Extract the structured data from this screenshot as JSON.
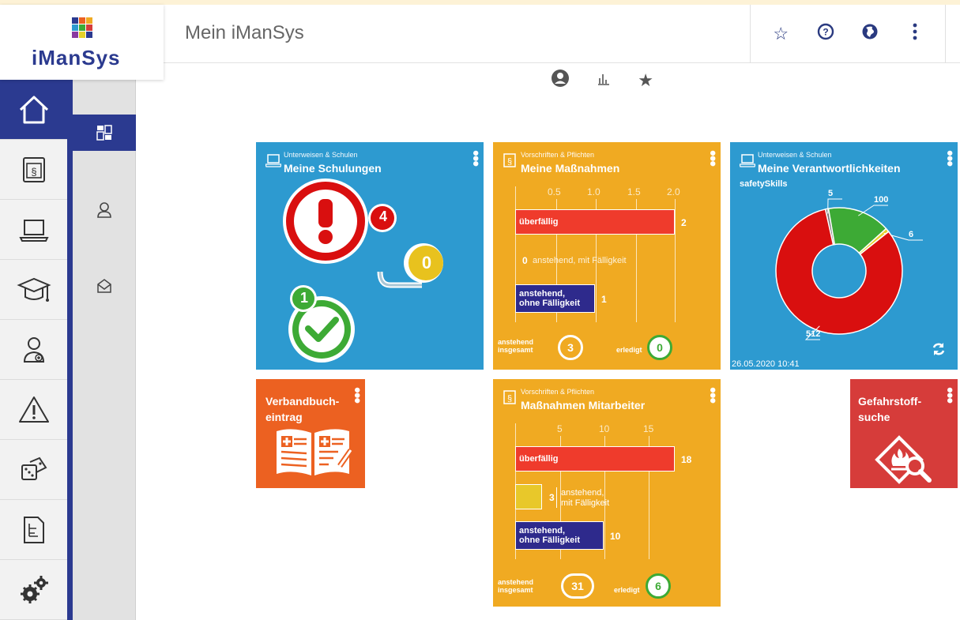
{
  "app": {
    "brand": "iManSys",
    "page_title": "Mein iManSys"
  },
  "header_icons": [
    "star-add-icon",
    "help-icon",
    "globe-icon",
    "more-vertical-icon"
  ],
  "sidebar": {
    "items": [
      {
        "name": "home",
        "active": true
      },
      {
        "name": "regulations"
      },
      {
        "name": "training-laptop"
      },
      {
        "name": "education"
      },
      {
        "name": "first-aid"
      },
      {
        "name": "warning"
      },
      {
        "name": "risk-dice"
      },
      {
        "name": "documents"
      },
      {
        "name": "settings"
      }
    ]
  },
  "subnav": {
    "items": [
      "dashboard",
      "profile",
      "messages"
    ]
  },
  "tiles": {
    "schulungen": {
      "kicker": "Unterweisen & Schulen",
      "title": "Meine Schulungen",
      "overdue": "4",
      "pending": "0",
      "done": "1"
    },
    "massnahmen": {
      "kicker": "Vorschriften & Pflichten",
      "title": "Meine Maßnahmen",
      "axis": [
        "0.5",
        "1.0",
        "1.5",
        "2.0"
      ],
      "bars": [
        {
          "label": "überfällig",
          "value": "2",
          "fraction": 1.0
        },
        {
          "label": "anstehend, mit Fälligkeit",
          "value": "0",
          "fraction": 0
        },
        {
          "label1": "anstehend,",
          "label2": "ohne Fälligkeit",
          "value": "1",
          "fraction": 0.5
        }
      ],
      "total_label1": "anstehend",
      "total_label2": "insgesamt",
      "total_value": "3",
      "done_label": "erledigt",
      "done_value": "0"
    },
    "verantwortlichkeiten": {
      "kicker": "Unterweisen & Schulen",
      "title": "Meine Verantwortlichkeiten",
      "subtitle": "safetySkills",
      "timestamp": "26.05.2020 10:41",
      "slices": [
        {
          "value": "5",
          "color": "#777777"
        },
        {
          "value": "100",
          "color": "#3daa35"
        },
        {
          "value": "6",
          "color": "#e6d22a"
        },
        {
          "value": "512",
          "color": "#d90f0f"
        }
      ]
    },
    "verbandbuch": {
      "title1": "Verbandbuch-",
      "title2": "eintrag"
    },
    "mitarbeiter": {
      "kicker": "Vorschriften & Pflichten",
      "title": "Maßnahmen Mitarbeiter",
      "axis": [
        "5",
        "10",
        "15"
      ],
      "bars": [
        {
          "label": "überfällig",
          "value": "18",
          "fraction": 1.0
        },
        {
          "label1": "anstehend,",
          "label2": "mit Fälligkeit",
          "value": "3",
          "fraction": 0.167
        },
        {
          "label1": "anstehend,",
          "label2": "ohne Fälligkeit",
          "value": "10",
          "fraction": 0.556
        }
      ],
      "total_label1": "anstehend",
      "total_label2": "insgesamt",
      "total_value": "31",
      "done_label": "erledigt",
      "done_value": "6"
    },
    "gefahrstoff": {
      "title1": "Gefahrstoff-",
      "title2": "suche"
    }
  },
  "colors": {
    "brand_blue": "#2b3a90",
    "tile_blue": "#2d9ad0",
    "tile_orange": "#f0aa22",
    "tile_deep_orange": "#ec6121",
    "tile_red": "#d63c3a",
    "bar_red": "#ef3b2c",
    "bar_navy": "#2e2a8c",
    "bar_yellow": "#e8c82a"
  }
}
